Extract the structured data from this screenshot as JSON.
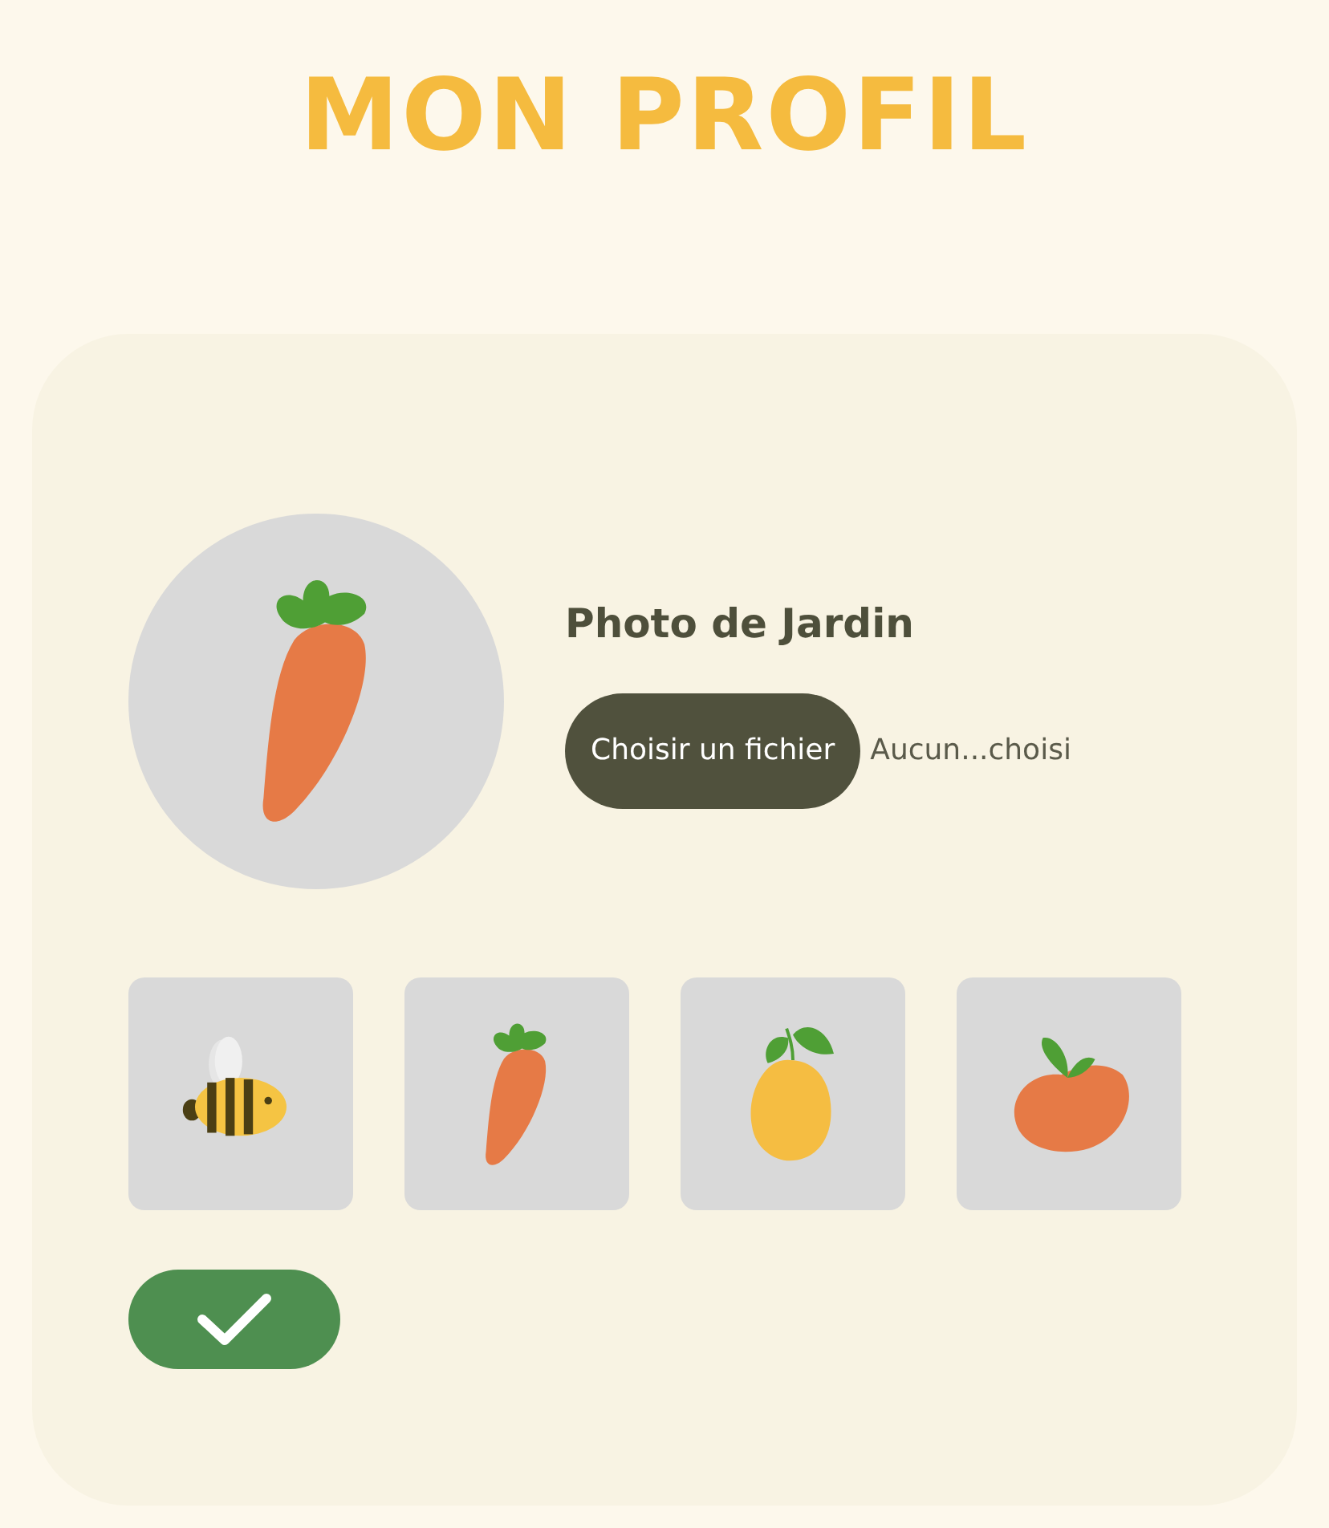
{
  "title": "MON PROFIL",
  "avatar": {
    "kind": "carrot"
  },
  "photo": {
    "label": "Photo de Jardin",
    "button": "Choisir un fichier",
    "file_status": "Aucun...choisi"
  },
  "choices": [
    {
      "kind": "bee"
    },
    {
      "kind": "carrot"
    },
    {
      "kind": "lemon"
    },
    {
      "kind": "tomato"
    }
  ]
}
